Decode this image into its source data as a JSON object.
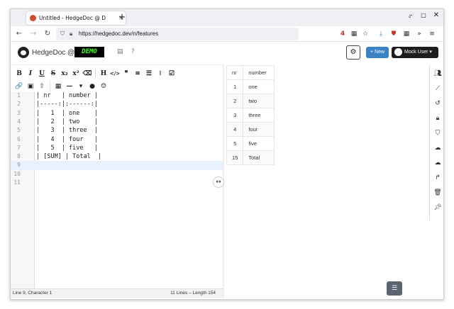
{
  "browser": {
    "tab_title": "Untitled - HedgeDoc @ D",
    "tab_close": "✕",
    "new_tab": "+",
    "url": "https://hedgedoc.dev/n/features",
    "ext_badge": "4"
  },
  "header": {
    "brand": "HedgeDoc @",
    "demo_logo": "DEMO",
    "new_label": "New",
    "user_label": "Mock User"
  },
  "toolbar": {
    "row1": [
      "B",
      "I",
      "U",
      "S",
      "x₂",
      "x²",
      "⌫",
      "H",
      "</>",
      "❞",
      "≡",
      "☰",
      "⁝",
      "☑"
    ],
    "row2": [
      "🔗",
      "▣",
      "⇧",
      "▦",
      "—",
      "▾",
      "●",
      "☺"
    ]
  },
  "editor": {
    "lines": [
      {
        "n": "1",
        "text": "| nr   | number |"
      },
      {
        "n": "2",
        "text": "|-----:|:------:|"
      },
      {
        "n": "3",
        "text": "|   1  | one    |"
      },
      {
        "n": "4",
        "text": "|   2  | two    |"
      },
      {
        "n": "5",
        "text": "|   3  | three  |"
      },
      {
        "n": "6",
        "text": "|   4  | four   |"
      },
      {
        "n": "7",
        "text": "|   5  | five   |"
      },
      {
        "n": "8",
        "text": "| [SUM] | Total  |"
      },
      {
        "n": "9",
        "text": ""
      },
      {
        "n": "10",
        "text": ""
      },
      {
        "n": "11",
        "text": ""
      }
    ],
    "status_left": "Line 9, Character 1",
    "status_right": "11 Lines – Length 154"
  },
  "preview": {
    "headers": [
      "nr",
      "number"
    ],
    "rows": [
      [
        "1",
        "one"
      ],
      [
        "2",
        "two"
      ],
      [
        "3",
        "three"
      ],
      [
        "4",
        "four"
      ],
      [
        "5",
        "five"
      ],
      [
        "15",
        "Total"
      ]
    ]
  },
  "colors": {
    "accent": "#3b82c4",
    "dark": "#1d1d1d",
    "demo_green": "#39ff14"
  }
}
